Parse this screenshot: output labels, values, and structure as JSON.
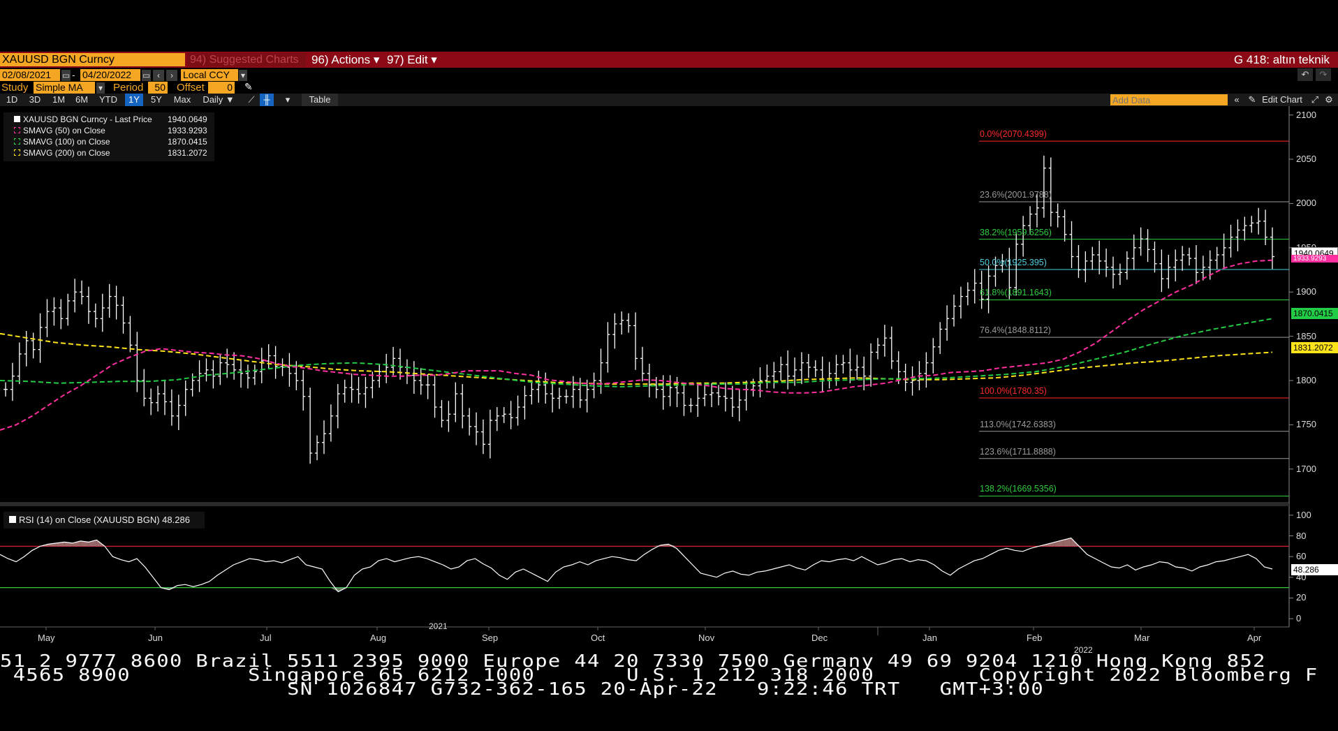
{
  "titlebar": {
    "ticker": "XAUUSD BGN Curncy",
    "suggested": "94) Suggested Charts",
    "actions": "96) Actions ▾",
    "edit": "97) Edit ▾",
    "chart_name": "G 418: altın teknik"
  },
  "controls": {
    "start_date": "02/08/2021",
    "dash": "-",
    "end_date": "04/20/2022",
    "currency": "Local CCY",
    "study_label": "Study",
    "study_value": "Simple MA",
    "period_label": "Period",
    "period_value": "50",
    "offset_label": "Offset",
    "offset_value": "0"
  },
  "ranges": [
    "1D",
    "3D",
    "1M",
    "6M",
    "YTD",
    "1Y",
    "5Y",
    "Max"
  ],
  "active_range": "1Y",
  "frequency": "Daily ▼",
  "table_label": "Table",
  "add_data_placeholder": "Add Data",
  "edit_chart_label": "Edit Chart",
  "colors": {
    "titlebar": "#8b0a16",
    "orange": "#f5a623",
    "price": "#ffffff",
    "sma50": "#ff2fa0",
    "sma100": "#22cc44",
    "sma200": "#ffe41a",
    "fib_red": "#ff2a2a",
    "fib_green": "#2ecc40",
    "fib_cyan": "#4dd0e1",
    "fib_grey": "#9a9a9a"
  },
  "legend": {
    "rows": [
      {
        "name": "XAUUSD BGN Curncy - Last Price",
        "value": "1940.0649"
      },
      {
        "name": "SMAVG (50)  on Close",
        "value": "1933.9293"
      },
      {
        "name": "SMAVG (100)  on Close",
        "value": "1870.0415"
      },
      {
        "name": "SMAVG (200)  on Close",
        "value": "1831.2072"
      }
    ]
  },
  "rsi_legend": "RSI (14)  on Close (XAUUSD BGN) 48.286",
  "price_tags": {
    "last": "1940.0649",
    "sma50": "1933.9293",
    "sma100": "1870.0415",
    "sma200": "1831.2072",
    "rsi": "48.286"
  },
  "chart_data": {
    "type": "bar",
    "title": "",
    "x_labels": [
      "May",
      "Jun",
      "Jul",
      "Aug",
      "Sep",
      "Oct",
      "Nov",
      "Dec",
      "Jan",
      "Feb",
      "Mar",
      "Apr"
    ],
    "year_labels": [
      "2021",
      "2022"
    ],
    "y_ticks": [
      1700,
      1750,
      1800,
      1850,
      1900,
      1950,
      2000,
      2050,
      2100
    ],
    "ylim": [
      1662,
      2110
    ],
    "price_series": [
      1790,
      1805,
      1830,
      1845,
      1835,
      1860,
      1878,
      1882,
      1870,
      1890,
      1900,
      1895,
      1878,
      1870,
      1882,
      1895,
      1885,
      1865,
      1840,
      1800,
      1780,
      1775,
      1785,
      1776,
      1760,
      1772,
      1790,
      1800,
      1808,
      1812,
      1805,
      1820,
      1818,
      1812,
      1808,
      1803,
      1810,
      1822,
      1828,
      1816,
      1815,
      1808,
      1800,
      1782,
      1718,
      1730,
      1740,
      1760,
      1785,
      1792,
      1790,
      1785,
      1792,
      1800,
      1810,
      1815,
      1825,
      1815,
      1806,
      1800,
      1795,
      1795,
      1770,
      1755,
      1762,
      1785,
      1760,
      1748,
      1742,
      1728,
      1755,
      1760,
      1762,
      1758,
      1770,
      1783,
      1790,
      1795,
      1785,
      1780,
      1782,
      1782,
      1790,
      1778,
      1790,
      1800,
      1820,
      1852,
      1864,
      1868,
      1862,
      1825,
      1808,
      1795,
      1790,
      1782,
      1792,
      1786,
      1772,
      1772,
      1780,
      1784,
      1786,
      1782,
      1780,
      1770,
      1778,
      1790,
      1794,
      1800,
      1805,
      1810,
      1818,
      1805,
      1812,
      1820,
      1815,
      1812,
      1800,
      1808,
      1818,
      1820,
      1812,
      1815,
      1805,
      1832,
      1840,
      1848,
      1822,
      1810,
      1798,
      1800,
      1808,
      1820,
      1838,
      1858,
      1870,
      1884,
      1895,
      1902,
      1910,
      1892,
      1918,
      1930,
      1935,
      1905,
      1954,
      1975,
      1988,
      1995,
      2040,
      1990,
      1985,
      1965,
      1940,
      1925,
      1935,
      1942,
      1935,
      1928,
      1920,
      1922,
      1938,
      1950,
      1960,
      1948,
      1932,
      1915,
      1928,
      1936,
      1942,
      1938,
      1922,
      1928,
      1936,
      1942,
      1950,
      1962,
      1970,
      1975,
      1978,
      1980,
      1962,
      1940
    ],
    "sma50": [
      1744,
      1750,
      1760,
      1772,
      1784,
      1794,
      1806,
      1818,
      1826,
      1833,
      1836,
      1834,
      1832,
      1831,
      1829,
      1828,
      1825,
      1820,
      1816,
      1814,
      1811,
      1809,
      1807,
      1806,
      1805,
      1805,
      1806,
      1806,
      1808,
      1811,
      1811,
      1811,
      1808,
      1806,
      1801,
      1799,
      1797,
      1796,
      1797,
      1799,
      1801,
      1800,
      1798,
      1796,
      1794,
      1791,
      1790,
      1789,
      1787,
      1786,
      1786,
      1787,
      1790,
      1793,
      1795,
      1797,
      1801,
      1805,
      1806,
      1809,
      1810,
      1811,
      1814,
      1816,
      1818,
      1820,
      1824,
      1832,
      1842,
      1855,
      1868,
      1880,
      1890,
      1900,
      1908,
      1918,
      1927,
      1932,
      1935,
      1936
    ],
    "sma100": [
      1800,
      1799,
      1797,
      1798,
      1799,
      1799,
      1801,
      1806,
      1809,
      1813,
      1817,
      1819,
      1820,
      1818,
      1814,
      1810,
      1806,
      1802,
      1798,
      1796,
      1794,
      1793,
      1794,
      1795,
      1796,
      1796,
      1798,
      1798,
      1800,
      1801,
      1802,
      1802,
      1803,
      1805,
      1807,
      1810,
      1816,
      1824,
      1832,
      1842,
      1851,
      1858,
      1864,
      1870
    ],
    "sma200": [
      1853,
      1848,
      1843,
      1840,
      1838,
      1835,
      1833,
      1830,
      1826,
      1822,
      1818,
      1816,
      1813,
      1811,
      1810,
      1808,
      1806,
      1804,
      1802,
      1800,
      1798,
      1797,
      1796,
      1796,
      1796,
      1797,
      1797,
      1798,
      1799,
      1801,
      1802,
      1803,
      1802,
      1801,
      1801,
      1802,
      1803,
      1806,
      1810,
      1814,
      1817,
      1820,
      1822,
      1825,
      1828,
      1830,
      1832
    ],
    "fibonacci": [
      {
        "label": "0.0%(2070.4399)",
        "price": 2070.4399,
        "color": "#ff2a2a"
      },
      {
        "label": "23.6%(2001.9788)",
        "price": 2001.9788,
        "color": "#9a9a9a"
      },
      {
        "label": "38.2%(1959.6256)",
        "price": 1959.6256,
        "color": "#2ecc40"
      },
      {
        "label": "50.0%(1925.395)",
        "price": 1925.395,
        "color": "#4dd0e1"
      },
      {
        "label": "61.8%(1891.1643)",
        "price": 1891.1643,
        "color": "#2ecc40"
      },
      {
        "label": "76.4%(1848.8112)",
        "price": 1848.8112,
        "color": "#9a9a9a"
      },
      {
        "label": "100.0%(1780.35)",
        "price": 1780.35,
        "color": "#ff2a2a"
      },
      {
        "label": "113.0%(1742.6383)",
        "price": 1742.6383,
        "color": "#9a9a9a"
      },
      {
        "label": "123.6%(1711.8888)",
        "price": 1711.8888,
        "color": "#9a9a9a"
      },
      {
        "label": "138.2%(1669.5356)",
        "price": 1669.5356,
        "color": "#2ecc40"
      }
    ],
    "rsi": {
      "y_ticks": [
        0,
        20,
        40,
        60,
        80,
        100
      ],
      "ylim": [
        -8,
        108
      ],
      "overbought": 70,
      "oversold": 30,
      "values": [
        62,
        58,
        55,
        60,
        66,
        70,
        72,
        73,
        74,
        73,
        75,
        74,
        76,
        70,
        60,
        57,
        55,
        58,
        50,
        40,
        30,
        28,
        32,
        33,
        31,
        33,
        36,
        42,
        47,
        52,
        55,
        58,
        57,
        55,
        56,
        54,
        57,
        60,
        52,
        50,
        48,
        36,
        26,
        30,
        42,
        48,
        50,
        56,
        58,
        55,
        57,
        59,
        60,
        58,
        55,
        52,
        48,
        50,
        56,
        58,
        53,
        49,
        42,
        38,
        45,
        48,
        44,
        40,
        36,
        45,
        50,
        52,
        55,
        52,
        56,
        58,
        60,
        59,
        57,
        56,
        62,
        67,
        71,
        72,
        68,
        60,
        52,
        44,
        42,
        40,
        44,
        46,
        43,
        42,
        45,
        46,
        48,
        50,
        52,
        49,
        47,
        52,
        56,
        55,
        57,
        58,
        56,
        60,
        56,
        52,
        54,
        57,
        58,
        55,
        57,
        56,
        52,
        46,
        42,
        48,
        52,
        56,
        58,
        62,
        66,
        68,
        66,
        65,
        68,
        70,
        72,
        74,
        76,
        78,
        70,
        62,
        58,
        54,
        50,
        49,
        52,
        47,
        50,
        52,
        55,
        54,
        50,
        49,
        46,
        50,
        52,
        55,
        56,
        58,
        60,
        62,
        58,
        50,
        48
      ]
    }
  },
  "footer": {
    "line1": "51 2 9777 8600 Brazil 5511 2395 9000 Europe 44 20 7330 7500 Germany 49 69 9204 1210 Hong Kong 852",
    "line2": " 4565 8900         Singapore 65 6212 1000       U.S. 1 212 318 2000        Copyright 2022 Bloomberg F",
    "line3": "                      SN 1026847 G732-362-165 20-Apr-22   9:22:46 TRT   GMT+3:00"
  }
}
